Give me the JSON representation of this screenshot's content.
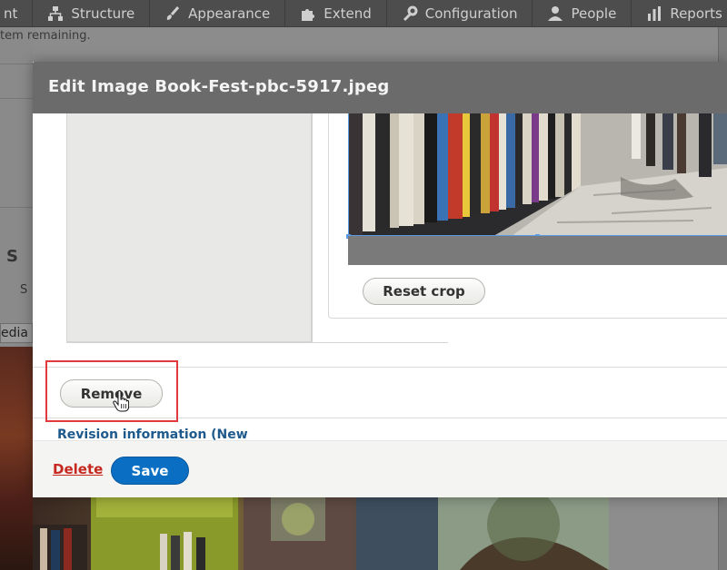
{
  "toolbar": {
    "items": [
      {
        "label": "nt",
        "icon": "none"
      },
      {
        "label": "Structure",
        "icon": "structure-icon"
      },
      {
        "label": "Appearance",
        "icon": "paintbrush-icon"
      },
      {
        "label": "Extend",
        "icon": "puzzle-icon"
      },
      {
        "label": "Configuration",
        "icon": "wrench-icon"
      },
      {
        "label": "People",
        "icon": "person-icon"
      },
      {
        "label": "Reports",
        "icon": "chart-icon"
      }
    ]
  },
  "background": {
    "status_text": "tem remaining.",
    "editor_s": "S",
    "editor_st": "S",
    "media_tab": "edia"
  },
  "modal": {
    "title": "Edit Image Book-Fest-pbc-5917.jpeg",
    "reset_crop_label": "Reset crop",
    "remove_label": "Remove",
    "revision_label": "Revision information (New",
    "delete_label": "Delete",
    "save_label": "Save"
  },
  "colors": {
    "header_bg": "#6b6b6b",
    "save_blue": "#0a6fc2",
    "delete_red": "#c6281f",
    "highlight_red": "#e0393e",
    "link_blue": "#1e5a8c"
  }
}
